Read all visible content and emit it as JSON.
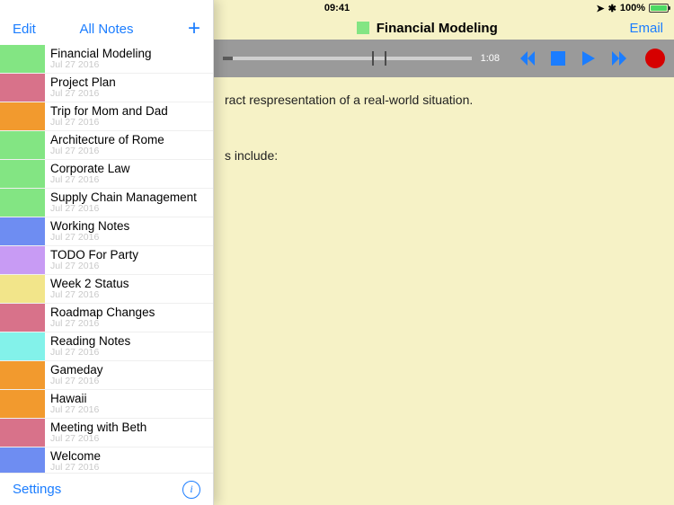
{
  "status": {
    "signal": "●●●●●",
    "time": "09:41",
    "nav_icon": "➤",
    "bt_icon": "✱",
    "battery_pct": "100%"
  },
  "header": {
    "note_title": "Financial Modeling",
    "swatch_color": "#83e583",
    "email_label": "Email"
  },
  "player": {
    "elapsed": "1:08",
    "progress_pct": 4,
    "markers_pct": [
      60,
      65
    ]
  },
  "note_body": {
    "line1": "ract respresentation of a real-world situation.",
    "line2": "s include:"
  },
  "sidebar": {
    "edit_label": "Edit",
    "center_label": "All Notes",
    "add_label": "+",
    "footer_settings": "Settings",
    "notes": [
      {
        "title": "Financial Modeling",
        "date": "Jul 27 2016",
        "color": "#83e583"
      },
      {
        "title": "Project Plan",
        "date": "Jul 27 2016",
        "color": "#d8728a"
      },
      {
        "title": "Trip for Mom and Dad",
        "date": "Jul 27 2016",
        "color": "#f29a2e"
      },
      {
        "title": "Architecture of Rome",
        "date": "Jul 27 2016",
        "color": "#83e583"
      },
      {
        "title": "Corporate Law",
        "date": "Jul 27 2016",
        "color": "#83e583"
      },
      {
        "title": "Supply Chain Management",
        "date": "Jul 27 2016",
        "color": "#83e583"
      },
      {
        "title": "Working Notes",
        "date": "Jul 27 2016",
        "color": "#6e8df2"
      },
      {
        "title": "TODO For Party",
        "date": "Jul 27 2016",
        "color": "#c89bf4"
      },
      {
        "title": "Week 2 Status",
        "date": "Jul 27 2016",
        "color": "#f2e58a"
      },
      {
        "title": "Roadmap Changes",
        "date": "Jul 27 2016",
        "color": "#d8728a"
      },
      {
        "title": "Reading Notes",
        "date": "Jul 27 2016",
        "color": "#83f2ea"
      },
      {
        "title": "Gameday",
        "date": "Jul 27 2016",
        "color": "#f29a2e"
      },
      {
        "title": "Hawaii",
        "date": "Jul 27 2016",
        "color": "#f29a2e"
      },
      {
        "title": "Meeting with Beth",
        "date": "Jul 27 2016",
        "color": "#d8728a"
      },
      {
        "title": "Welcome",
        "date": "Jul 27 2016",
        "color": "#6e8df2"
      }
    ]
  }
}
